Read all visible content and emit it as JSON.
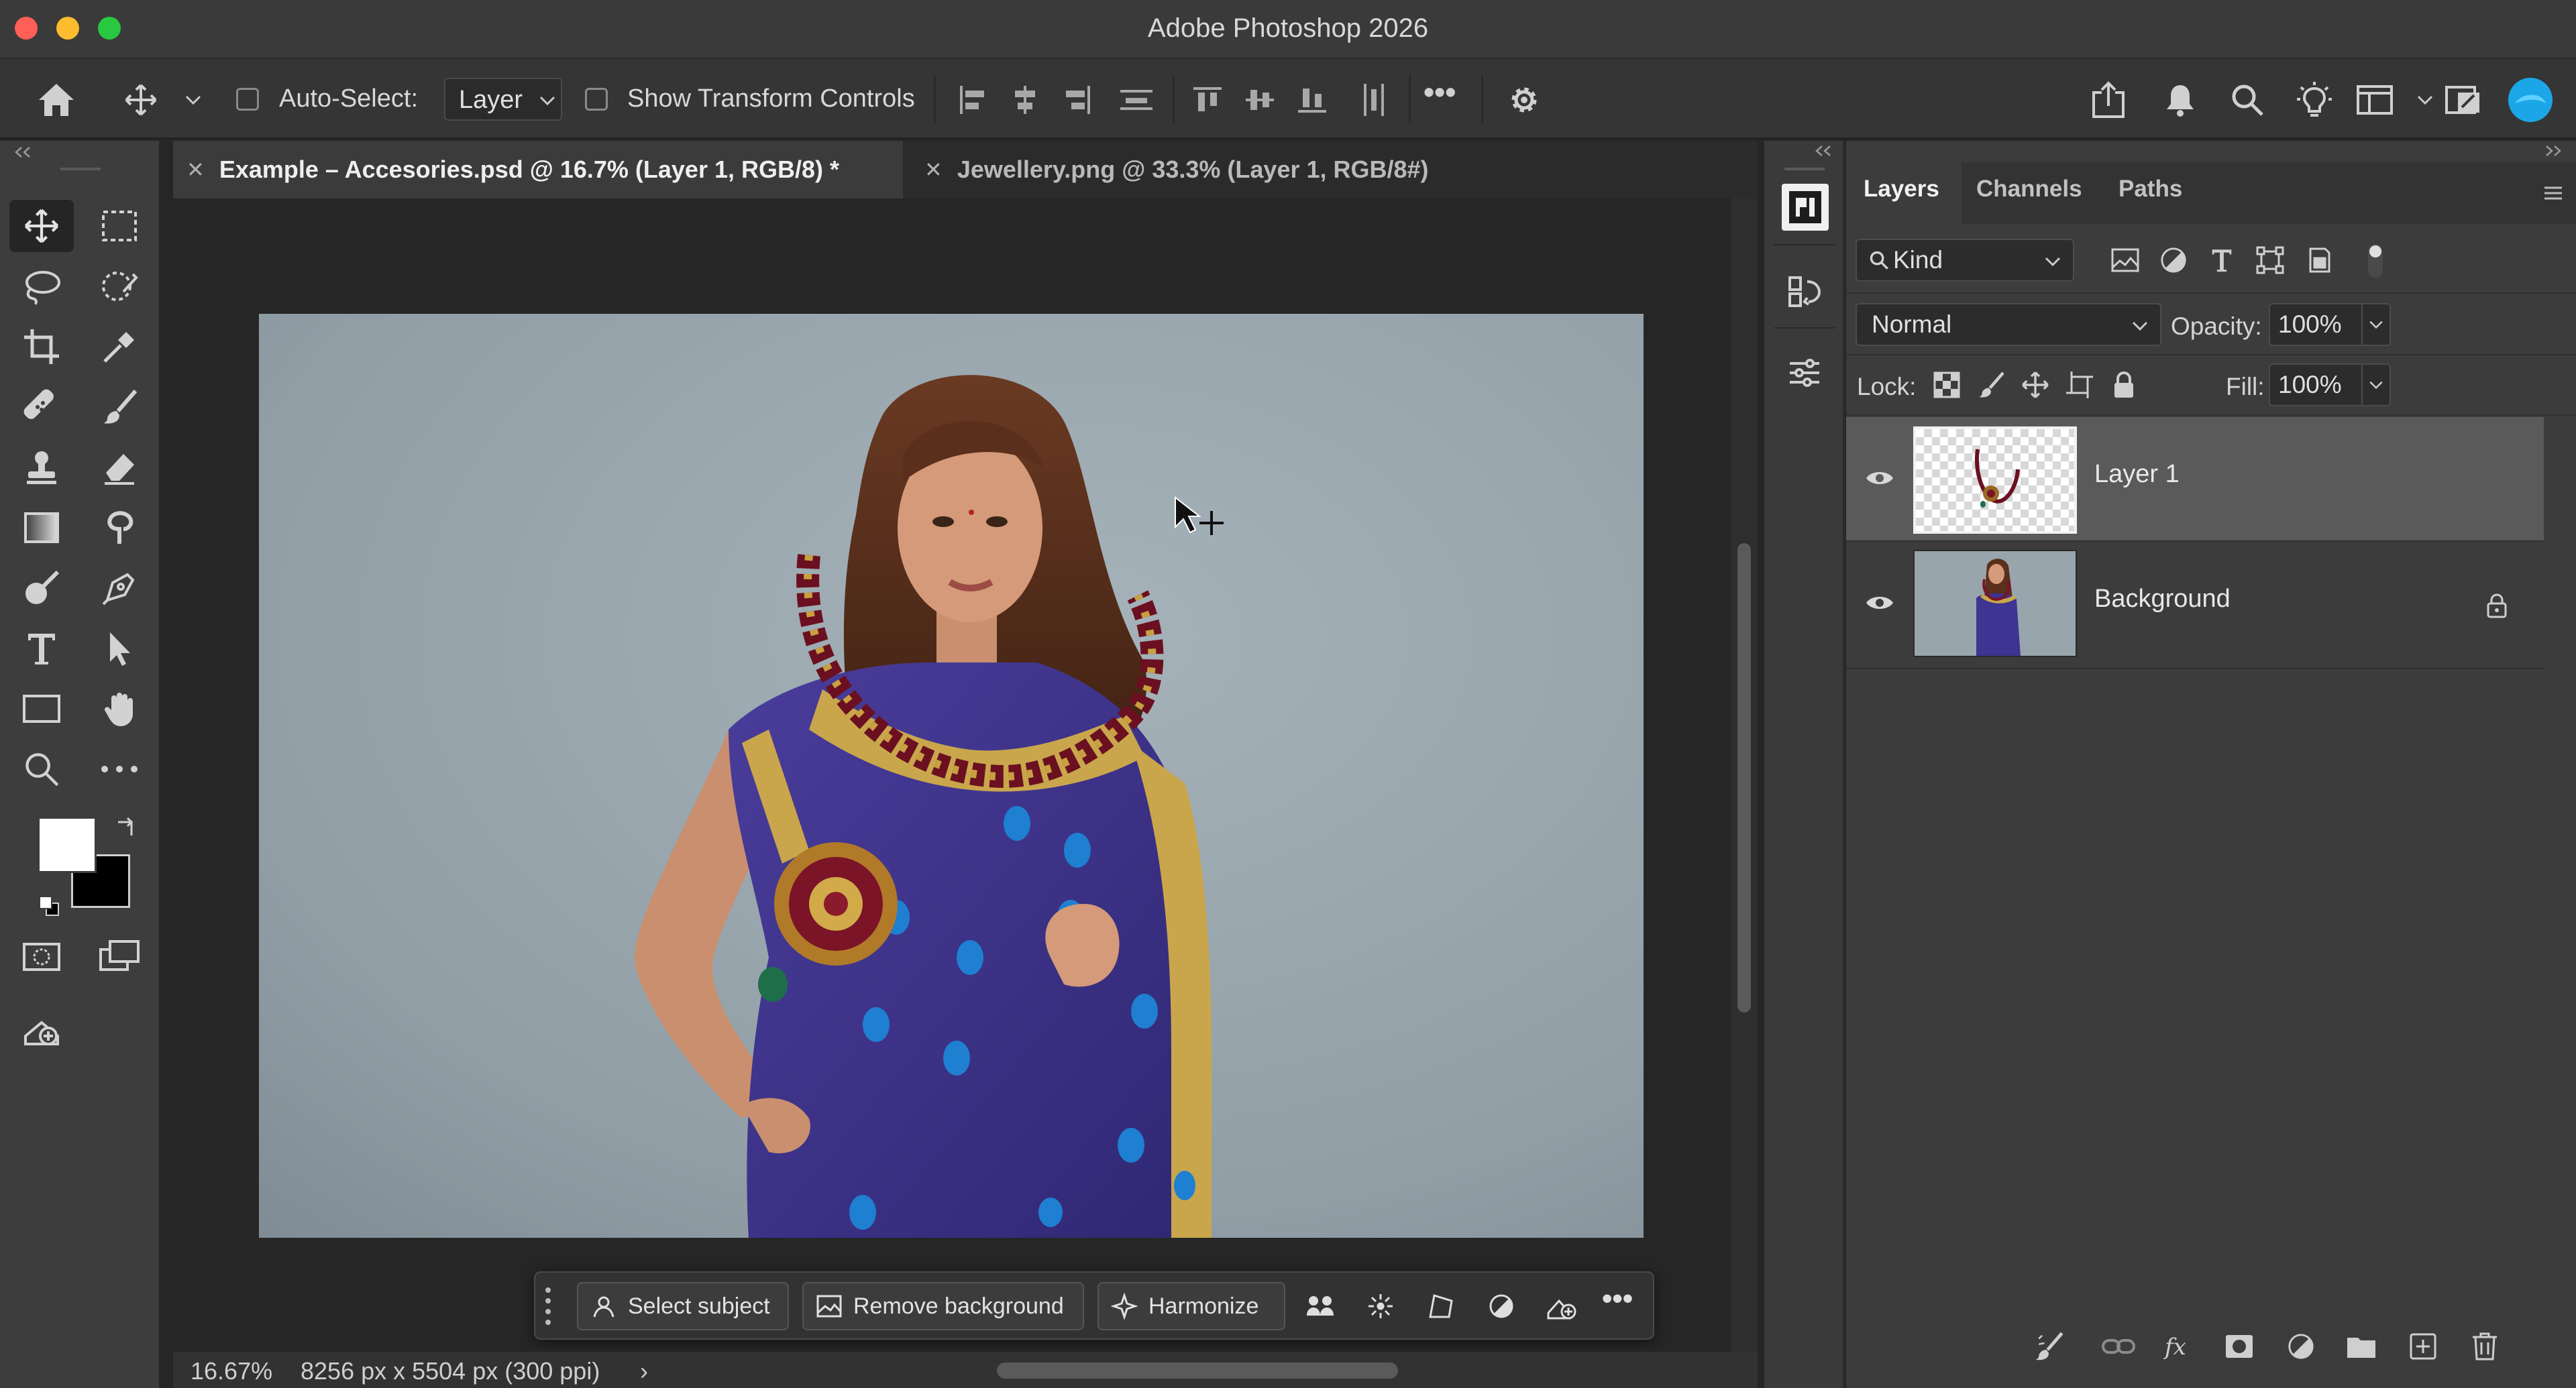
{
  "app": {
    "title": "Adobe Photoshop 2026"
  },
  "options_bar": {
    "auto_select_label": "Auto-Select:",
    "auto_select_value": "Layer",
    "transform_label": "Show Transform Controls",
    "more": "•••"
  },
  "tabs": [
    {
      "label": "Example – Accesories.psd @ 16.7% (Layer 1, RGB/8) *",
      "active": true
    },
    {
      "label": "Jewellery.png @ 33.3% (Layer 1, RGB/8#)",
      "active": false
    }
  ],
  "contextual_bar": {
    "select_subject": "Select subject",
    "remove_background": "Remove background",
    "harmonize": "Harmonize",
    "more": "•••"
  },
  "status": {
    "zoom": "16.67%",
    "doc_info": "8256 px x 5504 px (300 ppi)",
    "arrow": "›"
  },
  "panel": {
    "tabs": [
      "Layers",
      "Channels",
      "Paths"
    ],
    "active_tab": "Layers",
    "filter_kind": "Kind",
    "blend_mode": "Normal",
    "opacity_label": "Opacity:",
    "opacity_value": "100%",
    "lock_label": "Lock:",
    "fill_label": "Fill:",
    "fill_value": "100%",
    "layers": [
      {
        "name": "Layer 1",
        "visible": true,
        "selected": true,
        "locked": false
      },
      {
        "name": "Background",
        "visible": true,
        "selected": false,
        "locked": true
      }
    ]
  },
  "colors": {
    "foreground": "#ffffff",
    "background": "#000000",
    "accent": "#1ba6e8"
  }
}
